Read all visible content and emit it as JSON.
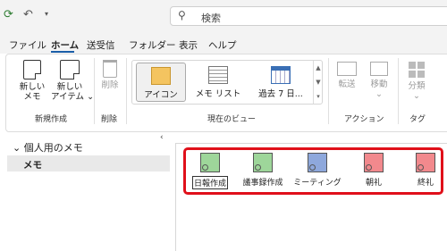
{
  "search": {
    "placeholder": "検索"
  },
  "menu": {
    "tabs": [
      "ファイル",
      "ホーム",
      "送受信",
      "フォルダー",
      "表示",
      "ヘルプ"
    ]
  },
  "ribbon": {
    "new_note": [
      "新しい",
      "メモ"
    ],
    "new_items": [
      "新しい",
      "アイテム ⌄"
    ],
    "group_new": "新規作成",
    "delete": "削除",
    "group_delete": "削除",
    "views": [
      "アイコン",
      "メモ リスト",
      "過去 7 日..."
    ],
    "group_view": "現在のビュー",
    "forward": "転送",
    "move": "移動",
    "group_action": "アクション",
    "categorize": "分類",
    "group_tag": "タグ"
  },
  "nav": {
    "folder_header": "個人用のメモ",
    "item": "メモ"
  },
  "notes": [
    {
      "label": "日報作成",
      "color": "#9ed69a"
    },
    {
      "label": "議事録作成",
      "color": "#9ed69a"
    },
    {
      "label": "ミーティング",
      "color": "#8ea8dc"
    },
    {
      "label": "朝礼",
      "color": "#f2898d"
    },
    {
      "label": "終礼",
      "color": "#f2898d"
    }
  ],
  "colors": {
    "accent": "#1a5ea8",
    "highlight": "#e0101a",
    "gallery_note": "#f4c460"
  }
}
